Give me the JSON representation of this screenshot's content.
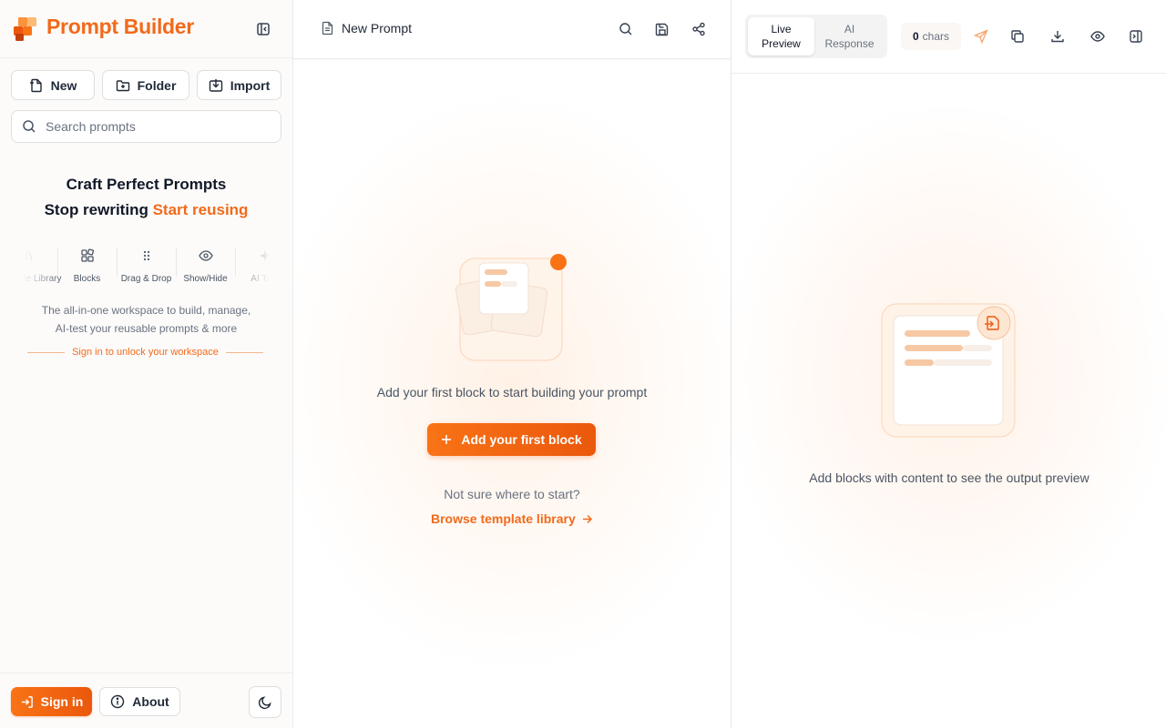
{
  "sidebar": {
    "brand": {
      "title": "Prompt Builder",
      "logo_icon": "layers-logo-icon"
    },
    "actions": {
      "new_label": "New",
      "folder_label": "Folder",
      "import_label": "Import"
    },
    "search": {
      "placeholder": "Search prompts",
      "value": ""
    },
    "hero": {
      "title": "Craft Perfect Prompts",
      "subtitle_plain": "Stop rewriting",
      "subtitle_accent": "Start reusing"
    },
    "features": [
      {
        "label": "Template Library",
        "icon": "library-icon"
      },
      {
        "label": "Blocks",
        "icon": "blocks-icon"
      },
      {
        "label": "Drag & Drop",
        "icon": "grip-icon"
      },
      {
        "label": "Show/Hide",
        "icon": "eye-icon"
      },
      {
        "label": "AI Test",
        "icon": "sparkle-icon"
      }
    ],
    "description": {
      "line1": "The all-in-one workspace to build, manage,",
      "line2": "AI-test your reusable prompts & more"
    },
    "signin_hint": "Sign in to unlock your workspace",
    "footer": {
      "signin_label": "Sign in",
      "about_label": "About",
      "theme_icon": "moon-icon"
    }
  },
  "editor": {
    "doc_title": "New Prompt",
    "empty_text": "Add your first block to start building your prompt",
    "add_block_label": "Add your first block",
    "not_sure_text": "Not sure where to start?",
    "browse_label": "Browse template library"
  },
  "preview": {
    "tabs": [
      {
        "label_line1": "Live",
        "label_line2": "Preview",
        "active": true
      },
      {
        "label_line1": "AI",
        "label_line2": "Response",
        "active": false
      }
    ],
    "chars_count": "0",
    "chars_unit": "chars",
    "empty_text": "Add blocks with content to see the output preview"
  },
  "colors": {
    "accent": "#f26a1b",
    "accent_dark": "#ea580c",
    "border": "#dedede",
    "muted_text": "#6b7280"
  }
}
